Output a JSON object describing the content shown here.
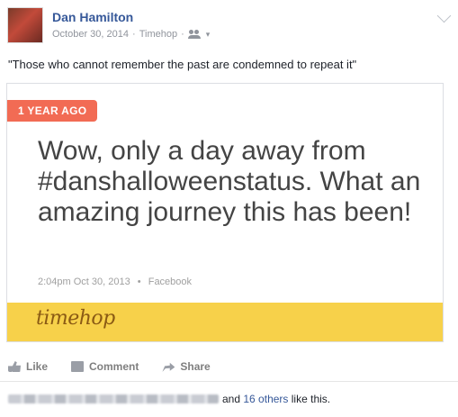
{
  "post": {
    "author": "Dan Hamilton",
    "date": "October 30, 2014",
    "source": "Timehop",
    "separator": "·",
    "audience_caret": "▾",
    "status_text": "\"Those who cannot remember the past are condemned to repeat it\""
  },
  "attachment": {
    "badge": "1 YEAR AGO",
    "text": "Wow, only a day away from #danshalloweenstatus. What an amazing journey this has been!",
    "timestamp": "2:04pm Oct 30, 2013",
    "dot": "•",
    "network": "Facebook",
    "logo": "timehop"
  },
  "actions": {
    "like": "Like",
    "comment": "Comment",
    "share": "Share"
  },
  "likes": {
    "and": "and",
    "others": "16 others",
    "suffix": "like this."
  },
  "colors": {
    "badge": "#f26b54",
    "band": "#f7d14a",
    "link": "#365899"
  }
}
